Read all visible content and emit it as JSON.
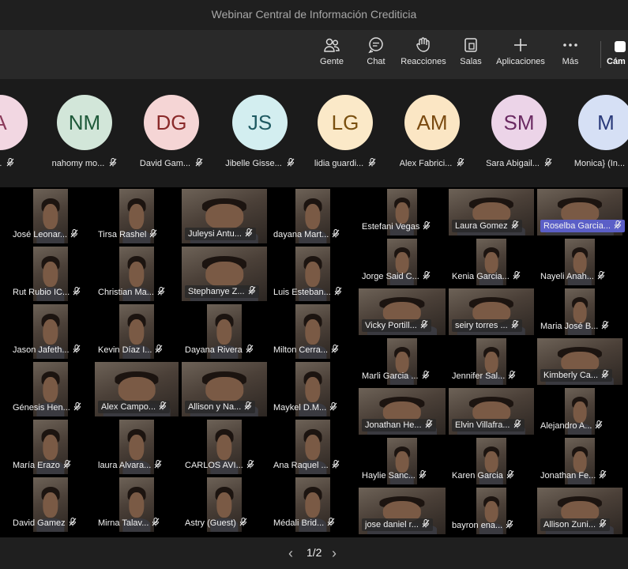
{
  "window": {
    "title": "Webinar Central de Información Crediticia"
  },
  "toolbar": {
    "items": [
      {
        "label": "Gente",
        "icon": "people-icon"
      },
      {
        "label": "Chat",
        "icon": "chat-icon"
      },
      {
        "label": "Reacciones",
        "icon": "raise-hand-icon"
      },
      {
        "label": "Salas",
        "icon": "rooms-icon"
      },
      {
        "label": "Aplicaciones",
        "icon": "add-icon"
      },
      {
        "label": "Más",
        "icon": "more-icon"
      }
    ],
    "camera_label": "Cám"
  },
  "attendees": [
    {
      "initials": "A",
      "name": "es...",
      "color": "#f2d7e2",
      "text_color": "#8a3a5a"
    },
    {
      "initials": "NM",
      "name": "nahomy mo...",
      "color": "#d2e6d9",
      "text_color": "#1f5a3a"
    },
    {
      "initials": "DG",
      "name": "David Gam...",
      "color": "#f5d5d5",
      "text_color": "#8a2a2a"
    },
    {
      "initials": "JS",
      "name": "Jibelle Gisse...",
      "color": "#d3eef0",
      "text_color": "#1f5a62"
    },
    {
      "initials": "LG",
      "name": "lidia guardi...",
      "color": "#fbe9c8",
      "text_color": "#7a5010"
    },
    {
      "initials": "AM",
      "name": "Alex Fabrici...",
      "color": "#fbe6c4",
      "text_color": "#7a4a10"
    },
    {
      "initials": "SM",
      "name": "Sara Abigail...",
      "color": "#ecd4e8",
      "text_color": "#6a2a62"
    },
    {
      "initials": "M",
      "name": "Monica} (In...",
      "color": "#d6e0f5",
      "text_color": "#2a3a7a"
    }
  ],
  "left_grid": [
    [
      "José Leonar...",
      "Tirsa Rashel",
      "Juleysi Antu...",
      "dayana Mart..."
    ],
    [
      "Rut Rubio IC...",
      "Christian Ma...",
      "Stephanye Z...",
      "Luis Esteban..."
    ],
    [
      "Jason Jafeth...",
      "Kevin Díaz I...",
      "Dayana Rivera",
      "Milton Cerra..."
    ],
    [
      "Génesis Hen...",
      "Alex Campo...",
      "Allison y Na...",
      "Maykel D.M..."
    ],
    [
      "María Erazo",
      "laura Alvara...",
      "CARLOS AVI...",
      "Ana Raquel ..."
    ],
    [
      "David Gamez",
      "Mirna Talav...",
      "Astry (Guest)",
      "Médali Brid..."
    ]
  ],
  "right_grid": [
    [
      "Estefani Vegas",
      "Laura Gomez",
      "Roselba Garcia..."
    ],
    [
      "Jorge Said C...",
      "Kenia Garcia...",
      "Nayeli Anah..."
    ],
    [
      "Vicky Portill...",
      "seiry torres ...",
      "Maria José B..."
    ],
    [
      "Marli Garcia ...",
      "Jennifer Sal...",
      "Kimberly Ca..."
    ],
    [
      "Jonathan He...",
      "Elvin Villafra...",
      "Alejandro A..."
    ],
    [
      "Haylie Sanc...",
      "Karen Garcia",
      "Jonathan Fe..."
    ],
    [
      "jose daniel r...",
      "bayron ena...",
      "Allison Zuni..."
    ]
  ],
  "pagination": {
    "label": "1/2"
  }
}
